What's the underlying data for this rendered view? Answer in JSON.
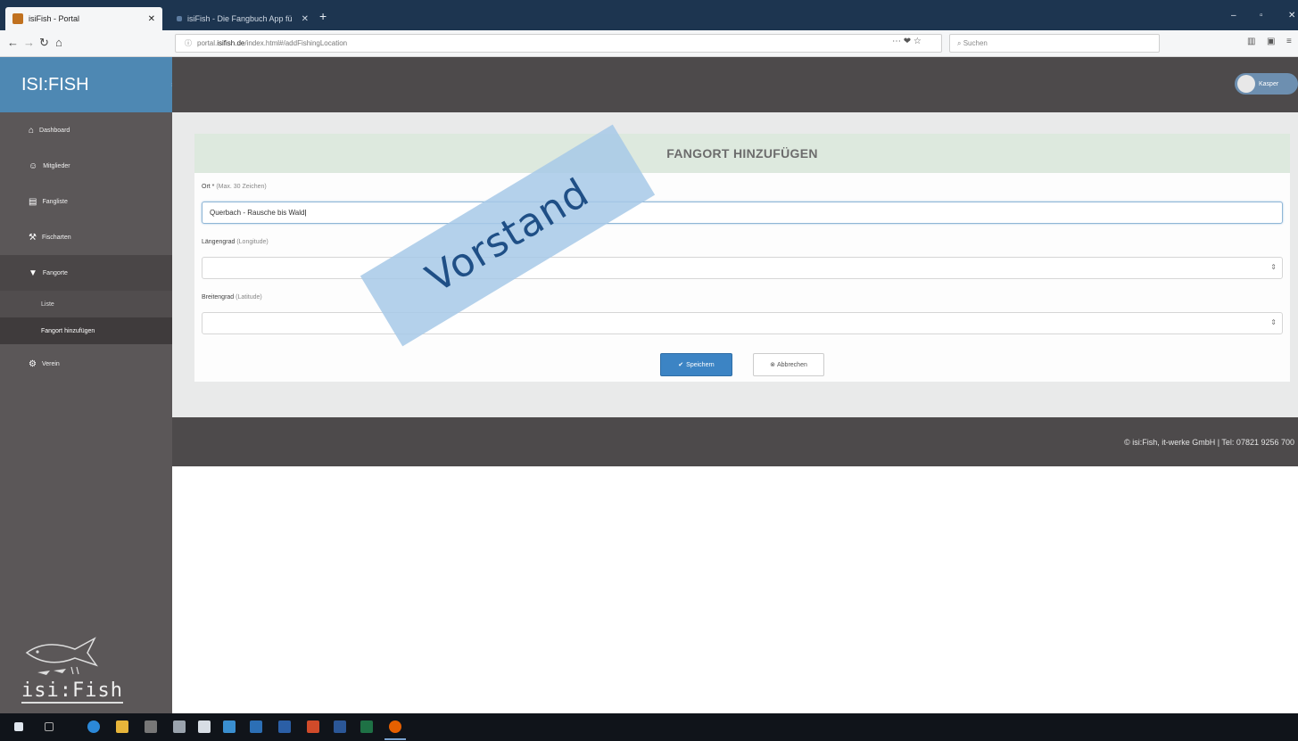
{
  "browser": {
    "tabs": [
      {
        "title": "isiFish - Portal",
        "active": true
      },
      {
        "title": "isiFish - Die Fangbuch App fü",
        "active": false
      }
    ],
    "url_prefix": "portal.",
    "url_domain": "isifish.de",
    "url_path": "/index.html#/addFishingLocation",
    "search_placeholder": "Suchen",
    "url_icons": "⋯ ❤ ☆"
  },
  "app": {
    "brand": "ISI:FISH",
    "user_name": "Kasper",
    "menu": [
      {
        "icon": "⌂",
        "label": "Dashboard"
      },
      {
        "icon": "☺",
        "label": "Mitglieder"
      },
      {
        "icon": "▤",
        "label": "Fangliste"
      },
      {
        "icon": "⚒",
        "label": "Fischarten"
      },
      {
        "icon": "▼",
        "label": "Fangorte"
      },
      {
        "icon": "⚙",
        "label": "Verein"
      }
    ],
    "submenu": [
      {
        "label": "Liste"
      },
      {
        "label": "Fangort hinzufügen"
      }
    ],
    "logo_text": "isi:Fish"
  },
  "form": {
    "title": "FANGORT HINZUFÜGEN",
    "ort_label": "Ort *",
    "ort_hint": "(Max. 30 Zeichen)",
    "ort_value": "Querbach - Rausche bis Wald",
    "lng_label": "Längengrad",
    "lng_hint": "(Longitude)",
    "lng_value": "",
    "lat_label": "Breitengrad",
    "lat_hint": "(Latitude)",
    "lat_value": "",
    "save_label": "Speichern",
    "cancel_label": "Abbrechen"
  },
  "footer": {
    "text": "© isi:Fish, it-werke GmbH | Tel: 07821 9256 700"
  },
  "watermark": {
    "text": "Vorstand"
  },
  "colors": {
    "brand_blue": "#4e88b3",
    "sidebar": "#5b5758",
    "save_button": "#3c84c4",
    "header_green": "#dde9de"
  }
}
